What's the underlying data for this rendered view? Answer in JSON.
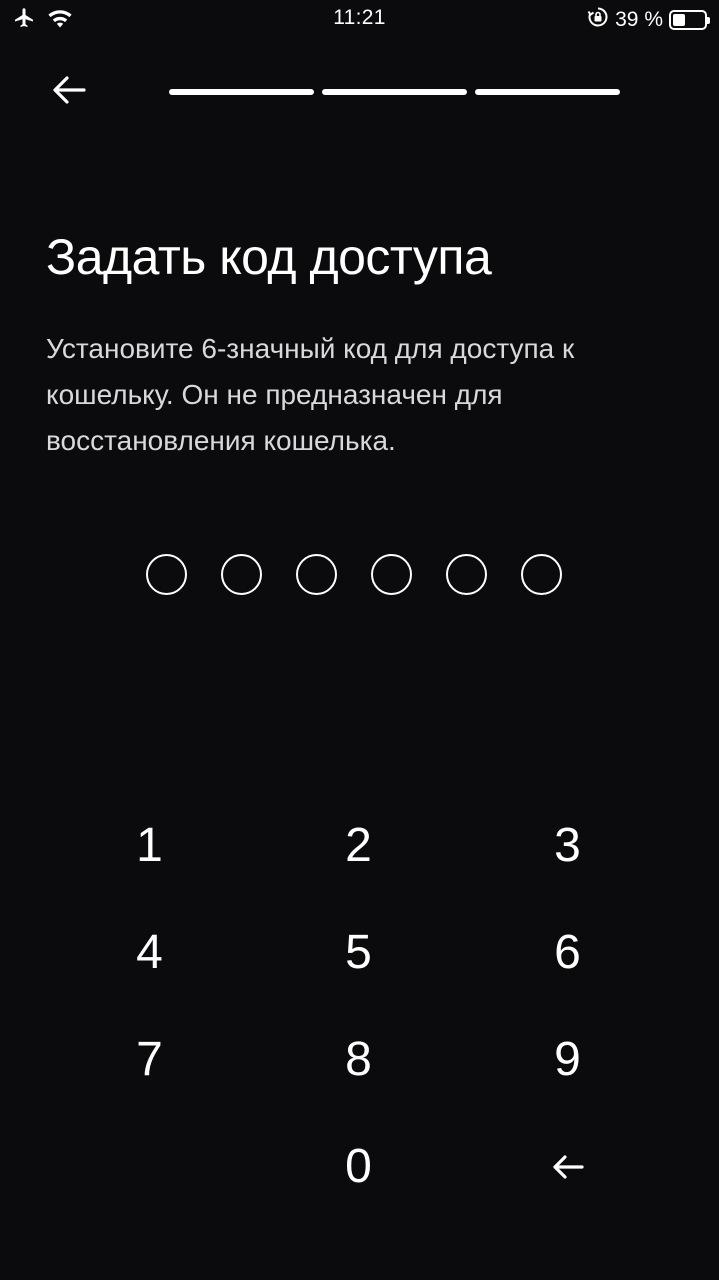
{
  "status_bar": {
    "time": "11:21",
    "battery_text": "39 %",
    "battery_level": 0.39,
    "icons": [
      "airplane-icon",
      "wifi-icon",
      "rotation-lock-icon",
      "battery-icon"
    ]
  },
  "header": {
    "back_icon": "arrow-left-icon",
    "progress_steps_total": 3,
    "progress_steps_completed": 3
  },
  "title": "Задать код доступа",
  "description": "Установите 6-значный код для доступа к кошельку. Он не предназначен для восстановления кошелька.",
  "pin": {
    "length": 6,
    "entered": 0
  },
  "keypad": {
    "keys": [
      "1",
      "2",
      "3",
      "4",
      "5",
      "6",
      "7",
      "8",
      "9",
      "",
      "0"
    ],
    "backspace_icon": "arrow-left-icon"
  },
  "colors": {
    "background": "#0b0b0d",
    "text": "#ffffff",
    "description_text": "#d9d9dc"
  }
}
